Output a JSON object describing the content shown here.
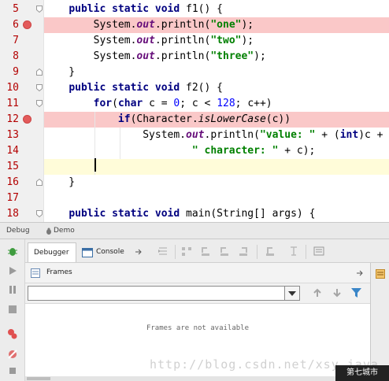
{
  "editor": {
    "lines": [
      {
        "num": "5",
        "breakpoint": false,
        "fold": true,
        "text": "    public static void f1() {"
      },
      {
        "num": "6",
        "breakpoint": true,
        "fold": false,
        "text": "        System.out.println(\"one\");"
      },
      {
        "num": "7",
        "breakpoint": false,
        "fold": false,
        "text": "        System.out.println(\"two\");"
      },
      {
        "num": "8",
        "breakpoint": false,
        "fold": false,
        "text": "        System.out.println(\"three\");"
      },
      {
        "num": "9",
        "breakpoint": false,
        "fold": true,
        "text": "    }"
      },
      {
        "num": "10",
        "breakpoint": false,
        "fold": true,
        "text": "    public static void f2() {"
      },
      {
        "num": "11",
        "breakpoint": false,
        "fold": true,
        "text": "        for(char c = 0; c < 128; c++)"
      },
      {
        "num": "12",
        "breakpoint": true,
        "fold": false,
        "text": "            if(Character.isLowerCase(c))"
      },
      {
        "num": "13",
        "breakpoint": false,
        "fold": false,
        "text": "                System.out.println(\"value: \" + (int)c +"
      },
      {
        "num": "14",
        "breakpoint": false,
        "fold": false,
        "text": "                        \" character: \" + c);"
      },
      {
        "num": "15",
        "breakpoint": false,
        "fold": false,
        "text": ""
      },
      {
        "num": "16",
        "breakpoint": false,
        "fold": true,
        "text": "    }"
      },
      {
        "num": "17",
        "breakpoint": false,
        "fold": false,
        "text": ""
      },
      {
        "num": "18",
        "breakpoint": false,
        "fold": true,
        "text": "    public static void main(String[] args) {"
      }
    ]
  },
  "debug_bar": {
    "debug_label": "Debug",
    "run_config": "Demo"
  },
  "tabs": {
    "debugger": "Debugger",
    "console": "Console"
  },
  "frames": {
    "title": "Frames",
    "empty_message": "Frames are not available",
    "thread_selected": ""
  },
  "watermark": "http://blog.csdn.net/xsy_java",
  "logo_text": "第七城市",
  "colors": {
    "breakpoint_line": "#fac8c8",
    "current_line": "#fffcd9",
    "keyword": "#000080",
    "string": "#008000",
    "static_field": "#660e7a"
  }
}
